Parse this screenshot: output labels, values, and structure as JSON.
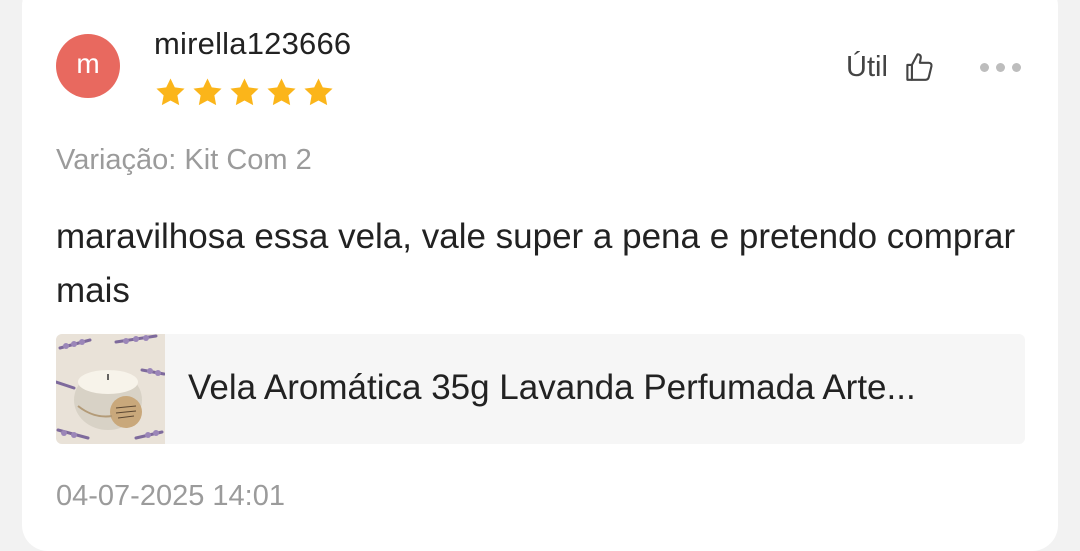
{
  "review": {
    "avatar_initial": "m",
    "username": "mirella123666",
    "rating": 5,
    "rating_max": 5,
    "helpful_label": "Útil",
    "variation": "Variação: Kit Com 2",
    "text": "maravilhosa essa vela, vale super a pena e pretendo comprar mais",
    "date": "04-07-2025 14:01"
  },
  "product": {
    "title": "Vela Aromática 35g Lavanda Perfumada Arte...",
    "image_icon": "lavender-candle-image"
  },
  "colors": {
    "avatar_bg": "#e8695f",
    "star": "#fbb51a",
    "muted_text": "#9b9b9b"
  },
  "icons": {
    "helpful": "thumbs-up-icon",
    "more": "more-options-icon",
    "star": "star-icon"
  }
}
